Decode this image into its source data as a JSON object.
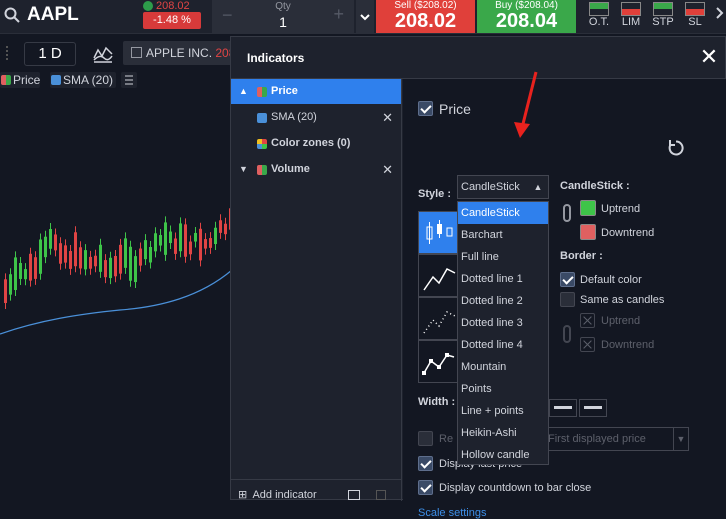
{
  "header": {
    "ticker": "AAPL",
    "last_price": "208.02",
    "change": "-1.48 %",
    "qty_label": "Qty",
    "qty_value": "1",
    "sell_label": "Sell ($208.02)",
    "sell_price": "208.02",
    "buy_label": "Buy ($208.04)",
    "buy_price": "208.04",
    "order_types": [
      "O.T.",
      "LIM",
      "STP",
      "SL"
    ]
  },
  "toolbar": {
    "timeframe": "1 D",
    "symbol_name": "APPLE INC.",
    "symbol_price": "208"
  },
  "legend": {
    "items": [
      {
        "label": "Price",
        "color": "#3aa84a"
      },
      {
        "label": "SMA (20)",
        "color": "#4a90d9"
      }
    ]
  },
  "panel": {
    "title": "Indicators",
    "tree": [
      {
        "label": "Price",
        "selected": true
      },
      {
        "label": "SMA (20)",
        "color": "#4a90d9"
      },
      {
        "label": "Color zones (0)"
      },
      {
        "label": "Volume"
      }
    ],
    "add_indicator": "Add indicator",
    "price_checkbox": "Price",
    "style_label": "Style :",
    "style_value": "CandleStick",
    "style_options": [
      "CandleStick",
      "Barchart",
      "Full line",
      "Dotted line 1",
      "Dotted line 2",
      "Dotted line 3",
      "Dotted line 4",
      "Mountain",
      "Points",
      "Line + points",
      "Heikin-Ashi",
      "Hollow candle"
    ],
    "candlestick_label": "CandleStick :",
    "uptrend": "Uptrend",
    "downtrend": "Downtrend",
    "uptrend_color": "#3ec449",
    "downtrend_color": "#e06060",
    "border_label": "Border :",
    "default_color": "Default color",
    "same_as_candles": "Same as candles",
    "border_uptrend": "Uptrend",
    "border_downtrend": "Downtrend",
    "width_label": "Width :",
    "range_label": "Re",
    "first_displayed_price": "First displayed price",
    "display_last_price": "Display last price",
    "display_countdown": "Display countdown to bar close",
    "scale_settings": "Scale settings"
  },
  "colors": {
    "accent": "#2f80ed",
    "sell": "#e0403a",
    "buy": "#3aa84a",
    "arrow": "#e8221e"
  }
}
